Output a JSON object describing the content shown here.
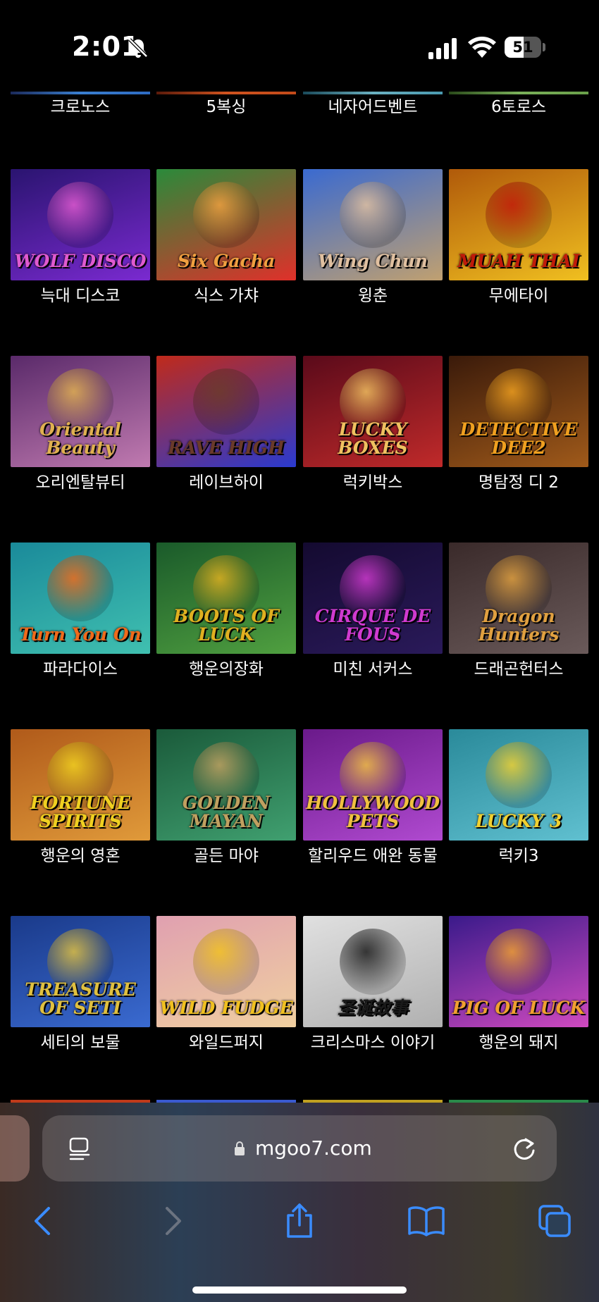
{
  "status_bar": {
    "time": "2:01",
    "battery": "51",
    "battery_level": 0.51,
    "icons": [
      "bell-muted-icon",
      "signal-icon",
      "wifi-icon",
      "battery-icon"
    ]
  },
  "games": [
    {
      "name": "크로노스",
      "logo": "",
      "colors": [
        "#1b2a5a",
        "#2e6bc2"
      ],
      "strip": "#3a7fd0"
    },
    {
      "name": "5복싱",
      "logo": "",
      "colors": [
        "#5a1a0a",
        "#c24a1a"
      ],
      "strip": "#d0531f"
    },
    {
      "name": "네자어드벤트",
      "logo": "",
      "colors": [
        "#1a4a5a",
        "#4a9ab0"
      ],
      "strip": "#6ab0c0"
    },
    {
      "name": "6토로스",
      "logo": "",
      "colors": [
        "#2a4a1a",
        "#6aa04a"
      ],
      "strip": "#7ab05a"
    },
    {
      "name": "늑대 디스코",
      "logo": "WOLF DISCO",
      "colors": [
        "#2a1470",
        "#7a2ad0"
      ],
      "accent": "#e05ad0"
    },
    {
      "name": "식스 가챠",
      "logo": "Six Gacha",
      "colors": [
        "#2a8a3a",
        "#e0302a"
      ],
      "accent": "#f0a040"
    },
    {
      "name": "윙춘",
      "logo": "Wing Chun",
      "colors": [
        "#3a6ad0",
        "#c0a070"
      ],
      "accent": "#e0c0a0"
    },
    {
      "name": "무에타이",
      "logo": "MUAH THAI",
      "colors": [
        "#b05a0a",
        "#f0c020"
      ],
      "accent": "#c01a0a"
    },
    {
      "name": "오리엔탈뷰티",
      "logo": "Oriental Beauty",
      "colors": [
        "#5a2a6a",
        "#c07ab0"
      ],
      "accent": "#e0b050"
    },
    {
      "name": "레이브하이",
      "logo": "RAVE HIGH",
      "colors": [
        "#c02a1a",
        "#2a3ad0"
      ],
      "accent": "#6a3a2a"
    },
    {
      "name": "럭키박스",
      "logo": "LUCKY BOXES",
      "colors": [
        "#5a0a1a",
        "#c02a2a"
      ],
      "accent": "#f0c060"
    },
    {
      "name": "명탐정 디 2",
      "logo": "DETECTIVE DEE2",
      "colors": [
        "#3a1a0a",
        "#a05a1a"
      ],
      "accent": "#f0a020"
    },
    {
      "name": "파라다이스",
      "logo": "Turn You On",
      "colors": [
        "#1a8a9a",
        "#40c0b0"
      ],
      "accent": "#f06a1a"
    },
    {
      "name": "행운의장화",
      "logo": "BOOTS OF LUCK",
      "colors": [
        "#1a5a2a",
        "#50a040"
      ],
      "accent": "#e0b020"
    },
    {
      "name": "미친 서커스",
      "logo": "CIRQUE DE FOUS",
      "colors": [
        "#140a30",
        "#2a1a5a"
      ],
      "accent": "#d03ad0"
    },
    {
      "name": "드래곤헌터스",
      "logo": "Dragon Hunters",
      "colors": [
        "#3a2a2a",
        "#6a5a5a"
      ],
      "accent": "#e0a040"
    },
    {
      "name": "행운의 영혼",
      "logo": "FORTUNE SPIRITS",
      "colors": [
        "#b05a1a",
        "#e09a3a"
      ],
      "accent": "#f0d020"
    },
    {
      "name": "골든 마야",
      "logo": "GOLDEN MAYAN",
      "colors": [
        "#1a5a3a",
        "#40a070"
      ],
      "accent": "#c0a060"
    },
    {
      "name": "할리우드 애완 동물",
      "logo": "HOLLYWOOD PETS",
      "colors": [
        "#6a1a8a",
        "#b04ad0"
      ],
      "accent": "#f0c040"
    },
    {
      "name": "럭키3",
      "logo": "LUCKY 3",
      "colors": [
        "#2a8a9a",
        "#60c0d0"
      ],
      "accent": "#f0d030"
    },
    {
      "name": "세티의 보물",
      "logo": "TREASURE OF SETI",
      "colors": [
        "#1a3a8a",
        "#3a6ad0"
      ],
      "accent": "#e0c040"
    },
    {
      "name": "와일드퍼지",
      "logo": "WILD FUDGE",
      "colors": [
        "#e0a0b0",
        "#f0d0a0"
      ],
      "accent": "#f0c020"
    },
    {
      "name": "크리스마스 이야기",
      "logo": "圣诞故事",
      "colors": [
        "#e0e0e0",
        "#b0b0b0"
      ],
      "accent": "#1a1a1a"
    },
    {
      "name": "행운의 돼지",
      "logo": "PIG OF LUCK",
      "colors": [
        "#3a1a8a",
        "#d04ac0"
      ],
      "accent": "#f0a030"
    }
  ],
  "browser": {
    "url": "mgoo7.com",
    "toolbar": [
      "back-icon",
      "forward-icon",
      "share-icon",
      "bookmarks-icon",
      "tabs-icon"
    ]
  }
}
